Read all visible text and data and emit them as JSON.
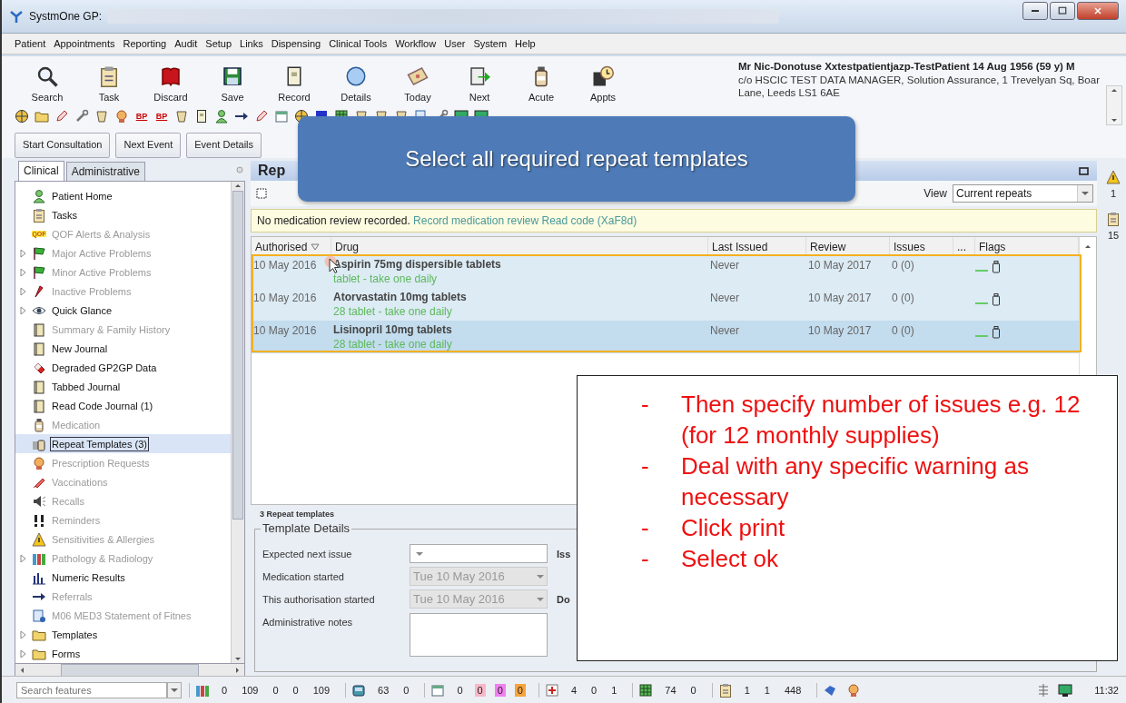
{
  "window": {
    "title": "SystmOne GP:"
  },
  "menu": [
    "Patient",
    "Appointments",
    "Reporting",
    "Audit",
    "Setup",
    "Links",
    "Dispensing",
    "Clinical Tools",
    "Workflow",
    "User",
    "System",
    "Help"
  ],
  "toolbar": [
    "Search",
    "Task",
    "Discard",
    "Save",
    "Record",
    "Details",
    "Today",
    "Next",
    "Acute",
    "Appts"
  ],
  "icon_bar": [
    {
      "kind": "icon"
    },
    {
      "kind": "icon"
    },
    {
      "kind": "icon"
    },
    {
      "kind": "icon"
    },
    {
      "kind": "icon"
    },
    {
      "kind": "icon"
    },
    {
      "kind": "badge",
      "text": "BP"
    },
    {
      "kind": "badge",
      "text": "BP"
    },
    {
      "kind": "icon"
    },
    {
      "kind": "icon"
    },
    {
      "kind": "icon"
    },
    {
      "kind": "icon"
    },
    {
      "kind": "icon"
    },
    {
      "kind": "icon"
    },
    {
      "kind": "icon"
    },
    {
      "kind": "icon"
    },
    {
      "kind": "icon"
    },
    {
      "kind": "icon"
    },
    {
      "kind": "icon"
    },
    {
      "kind": "icon"
    },
    {
      "kind": "icon"
    },
    {
      "kind": "icon"
    },
    {
      "kind": "icon"
    },
    {
      "kind": "icon"
    }
  ],
  "patient": {
    "name": "Mr Nic-Donotuse Xxtestpatientjazp-TestPatient 14 Aug 1956 (59 y) M",
    "address": "c/o HSCIC TEST DATA MANAGER, Solution Assurance, 1 Trevelyan Sq, Boar Lane, Leeds LS1 6AE"
  },
  "actions": [
    "Start Consultation",
    "Next Event",
    "Event Details"
  ],
  "callout": {
    "text": "Select all required repeat templates"
  },
  "sidebar": {
    "tabs": [
      {
        "label": "Clinical",
        "selected": true
      },
      {
        "label": "Administrative",
        "selected": false
      }
    ],
    "items": [
      {
        "label": "Patient Home",
        "expandable": false,
        "dim": false,
        "selected": false
      },
      {
        "label": "Tasks",
        "expandable": false,
        "dim": false,
        "selected": false
      },
      {
        "label": "QOF Alerts & Analysis",
        "badge": "QOF",
        "expandable": false,
        "dim": true,
        "selected": false
      },
      {
        "label": "Major Active Problems",
        "expandable": true,
        "dim": true,
        "selected": false
      },
      {
        "label": "Minor Active Problems",
        "expandable": true,
        "dim": true,
        "selected": false
      },
      {
        "label": "Inactive Problems",
        "expandable": true,
        "dim": true,
        "selected": false
      },
      {
        "label": "Quick Glance",
        "expandable": true,
        "dim": false,
        "selected": false
      },
      {
        "label": "Summary & Family History",
        "expandable": false,
        "dim": true,
        "selected": false
      },
      {
        "label": "New Journal",
        "expandable": false,
        "dim": false,
        "selected": false
      },
      {
        "label": "Degraded GP2GP Data",
        "expandable": false,
        "dim": false,
        "selected": false
      },
      {
        "label": "Tabbed Journal",
        "expandable": false,
        "dim": false,
        "selected": false
      },
      {
        "label": "Read Code Journal (1)",
        "expandable": false,
        "dim": false,
        "selected": false
      },
      {
        "label": "Medication",
        "expandable": false,
        "dim": true,
        "selected": false
      },
      {
        "label": "Repeat Templates (3)",
        "expandable": false,
        "dim": false,
        "selected": true
      },
      {
        "label": "Prescription Requests",
        "expandable": false,
        "dim": true,
        "selected": false
      },
      {
        "label": "Vaccinations",
        "expandable": false,
        "dim": true,
        "selected": false
      },
      {
        "label": "Recalls",
        "expandable": false,
        "dim": true,
        "selected": false
      },
      {
        "label": "Reminders",
        "expandable": false,
        "dim": true,
        "selected": false
      },
      {
        "label": "Sensitivities & Allergies",
        "expandable": false,
        "dim": true,
        "selected": false
      },
      {
        "label": "Pathology & Radiology",
        "expandable": true,
        "dim": true,
        "selected": false
      },
      {
        "label": "Numeric Results",
        "expandable": false,
        "dim": false,
        "selected": false
      },
      {
        "label": "Referrals",
        "expandable": false,
        "dim": true,
        "selected": false
      },
      {
        "label": "M06 MED3 Statement of Fitnes",
        "expandable": false,
        "dim": true,
        "selected": false
      },
      {
        "label": "Templates",
        "expandable": true,
        "dim": false,
        "selected": false
      },
      {
        "label": "Forms",
        "expandable": true,
        "dim": false,
        "selected": false
      }
    ]
  },
  "panel": {
    "title": "Rep",
    "view_label": "View",
    "view_value": "Current repeats",
    "warning": {
      "text": "No medication review recorded.",
      "link": "Record medication review Read code (XaF8d)"
    },
    "table": {
      "columns": [
        "Authorised",
        "Drug",
        "Last Issued",
        "Review",
        "Issues",
        "...",
        "Flags"
      ],
      "rows": [
        {
          "authorised": "10 May 2016",
          "drug": "Aspirin 75mg dispersible tablets",
          "directions": "tablet - take one daily",
          "last_issued": "Never",
          "review": "10 May 2017",
          "issues": "0 (0)",
          "selected": true,
          "focused": false
        },
        {
          "authorised": "10 May 2016",
          "drug": "Atorvastatin 10mg tablets",
          "directions": "28 tablet - take one daily",
          "last_issued": "Never",
          "review": "10 May 2017",
          "issues": "0 (0)",
          "selected": true,
          "focused": false
        },
        {
          "authorised": "10 May 2016",
          "drug": "Lisinopril 10mg tablets",
          "directions": "28 tablet - take one daily",
          "last_issued": "Never",
          "review": "10 May 2017",
          "issues": "0 (0)",
          "selected": true,
          "focused": true
        }
      ]
    },
    "footer": "3 Repeat templates",
    "details": {
      "title": "Template Details",
      "fields": [
        {
          "kind": "dropdown",
          "label": "Expected next issue",
          "disabled": false,
          "side_label": "Iss"
        },
        {
          "kind": "dropdown",
          "label": "Medication started",
          "value": "Tue 10 May 2016",
          "disabled": true
        },
        {
          "kind": "dropdown",
          "label": "This authorisation started",
          "value": "Tue 10 May 2016",
          "disabled": true,
          "side_label": "Do"
        },
        {
          "kind": "textarea",
          "label": "Administrative notes"
        }
      ]
    }
  },
  "side_strip": {
    "counts": [
      "1",
      "15"
    ]
  },
  "note": {
    "items": [
      {
        "bullet": "-",
        "text": "Then specify number of issues e.g. 12 (for 12 monthly supplies)"
      },
      {
        "bullet": "-",
        "text": "Deal with any specific warning as necessary"
      },
      {
        "bullet": "-",
        "text": "Click print"
      },
      {
        "bullet": "-",
        "text": "Select ok"
      }
    ]
  },
  "status_bar": {
    "search_placeholder": "Search features",
    "groups": [
      {
        "values": [
          {
            "text": "0"
          },
          {
            "text": "109"
          },
          {
            "text": "0"
          },
          {
            "text": "0"
          },
          {
            "text": "109"
          }
        ]
      },
      {
        "values": [
          {
            "text": "63"
          },
          {
            "text": "0"
          }
        ]
      },
      {
        "values": [
          {
            "text": "0"
          },
          {
            "text": "0",
            "color": "#f8b8c8"
          },
          {
            "text": "0",
            "color": "#f080f0"
          },
          {
            "text": "0",
            "color": "#f7a43c"
          }
        ]
      },
      {
        "values": [
          {
            "text": "4"
          },
          {
            "text": "0"
          },
          {
            "text": "1"
          }
        ]
      },
      {
        "values": [
          {
            "text": "74"
          },
          {
            "text": "0"
          }
        ]
      },
      {
        "values": [
          {
            "text": "1"
          },
          {
            "text": "1"
          },
          {
            "text": "448"
          }
        ]
      }
    ],
    "time": "11:32"
  }
}
